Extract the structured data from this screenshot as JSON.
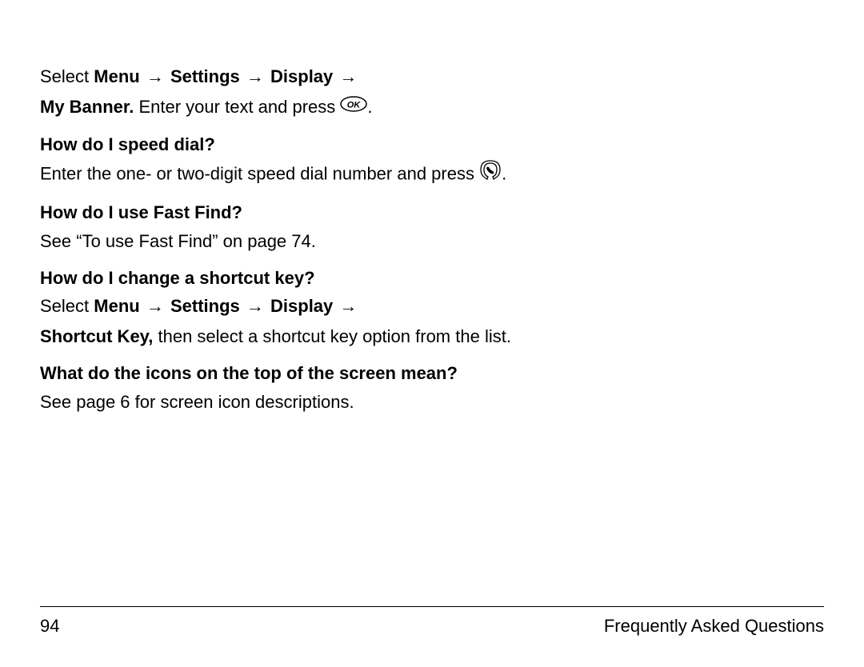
{
  "para1": {
    "prefix": "Select ",
    "menu": "Menu",
    "settings": "Settings",
    "display": "Display"
  },
  "para1b": {
    "mybanner": "My Banner.",
    "rest": " Enter your text and press ",
    "period": "."
  },
  "q1": "How do I speed dial?",
  "a1_pre": "Enter the one- or two-digit speed dial number and press ",
  "a1_post": ".",
  "q2": "How do I use Fast Find?",
  "a2": "See “To use Fast Find” on page 74.",
  "q3": "How do I change a shortcut key?",
  "a3a": {
    "prefix": "Select ",
    "menu": "Menu",
    "settings": "Settings",
    "display": "Display"
  },
  "a3b": {
    "shortcut": "Shortcut Key,",
    "rest": " then select a shortcut key option from the list."
  },
  "q4": "What do the icons on the top of the screen mean?",
  "a4": "See page 6 for screen icon descriptions.",
  "arrow": "→",
  "footer": {
    "page": "94",
    "section": "Frequently Asked Questions"
  },
  "icons": {
    "ok": "OK",
    "call": "call"
  }
}
